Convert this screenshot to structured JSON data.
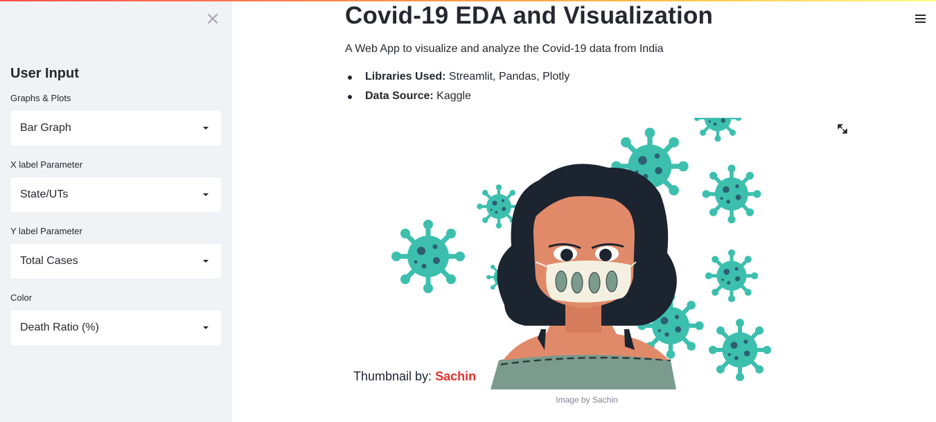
{
  "sidebar": {
    "close_symbol": "×",
    "title": "User Input",
    "fields": [
      {
        "label": "Graphs & Plots",
        "value": "Bar Graph"
      },
      {
        "label": "X label Parameter",
        "value": "State/UTs"
      },
      {
        "label": "Y label Parameter",
        "value": "Total Cases"
      },
      {
        "label": "Color",
        "value": "Death Ratio (%)"
      }
    ]
  },
  "main": {
    "title": "Covid-19 EDA and Visualization",
    "subtitle": "A Web App to visualize and analyze the Covid-19 data from India",
    "info": [
      {
        "key": "Libraries Used:",
        "value": " Streamlit, Pandas, Plotly"
      },
      {
        "key": "Data Source:",
        "value": " Kaggle"
      }
    ],
    "image": {
      "thumbnail_prefix": "Thumbnail by: ",
      "thumbnail_author": "Sachin",
      "caption": "Image by Sachin"
    }
  },
  "colors": {
    "accent": "#ff4b4b",
    "sidebar_bg": "#f0f2f6",
    "virus": "#3dbfae",
    "virus_dark": "#2d5f73",
    "hair": "#1c2430",
    "skin": "#e08a6a",
    "shirt": "#7a9b8e"
  },
  "icons": {
    "close": "close-icon",
    "menu": "hamburger-menu-icon",
    "caret": "chevron-down-icon",
    "fullscreen": "fullscreen-icon"
  }
}
